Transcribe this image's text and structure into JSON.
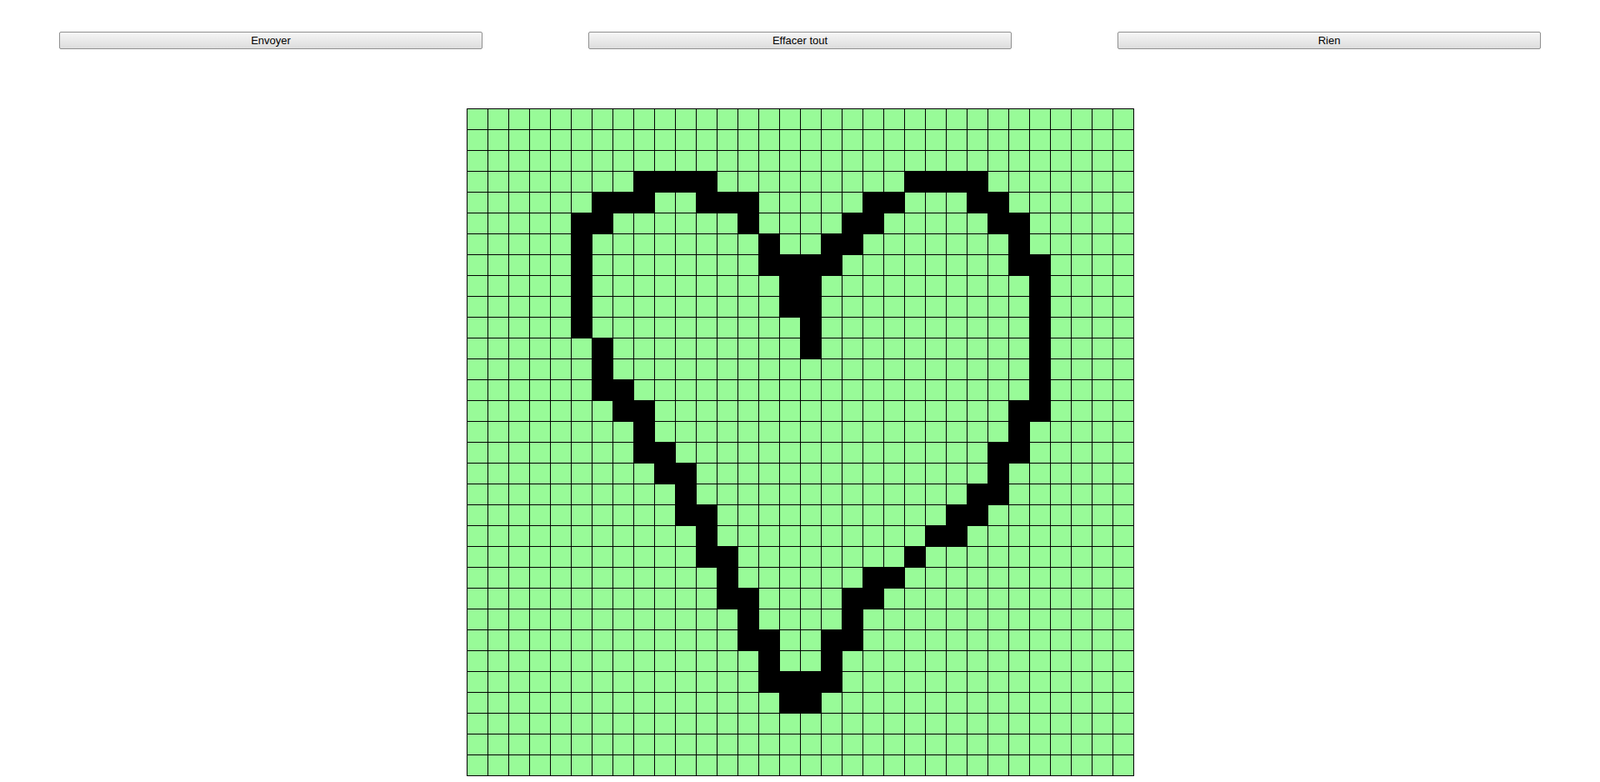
{
  "buttons": [
    {
      "label": "Envoyer"
    },
    {
      "label": "Effacer tout"
    },
    {
      "label": "Rien"
    }
  ],
  "grid": {
    "filled_char": "#",
    "rows": [
      "................................",
      "................................",
      "................................",
      "........####.........####.......",
      "......###..###.....##...##......",
      ".....##......#....##.....##.....",
      ".....#........#..##.......#.....",
      ".....#........####........##....",
      ".....#.........##..........#....",
      ".....#.........##..........#....",
      ".....#..........#..........#....",
      "......#.........#..........#....",
      "......#....................#....",
      "......##...................#....",
      ".......##.................##....",
      "........#.................#.....",
      "........##...............##.....",
      ".........##..............#......",
      "..........#.............##......",
      "..........##...........##.......",
      "...........#..........##........",
      "...........##........#..........",
      "............#......##...........",
      "............##....##............",
      ".............#....#.............",
      ".............##..##.............",
      "..............#..#..............",
      "..............####..............",
      "...............##...............",
      "................................",
      "................................",
      "................................"
    ]
  }
}
